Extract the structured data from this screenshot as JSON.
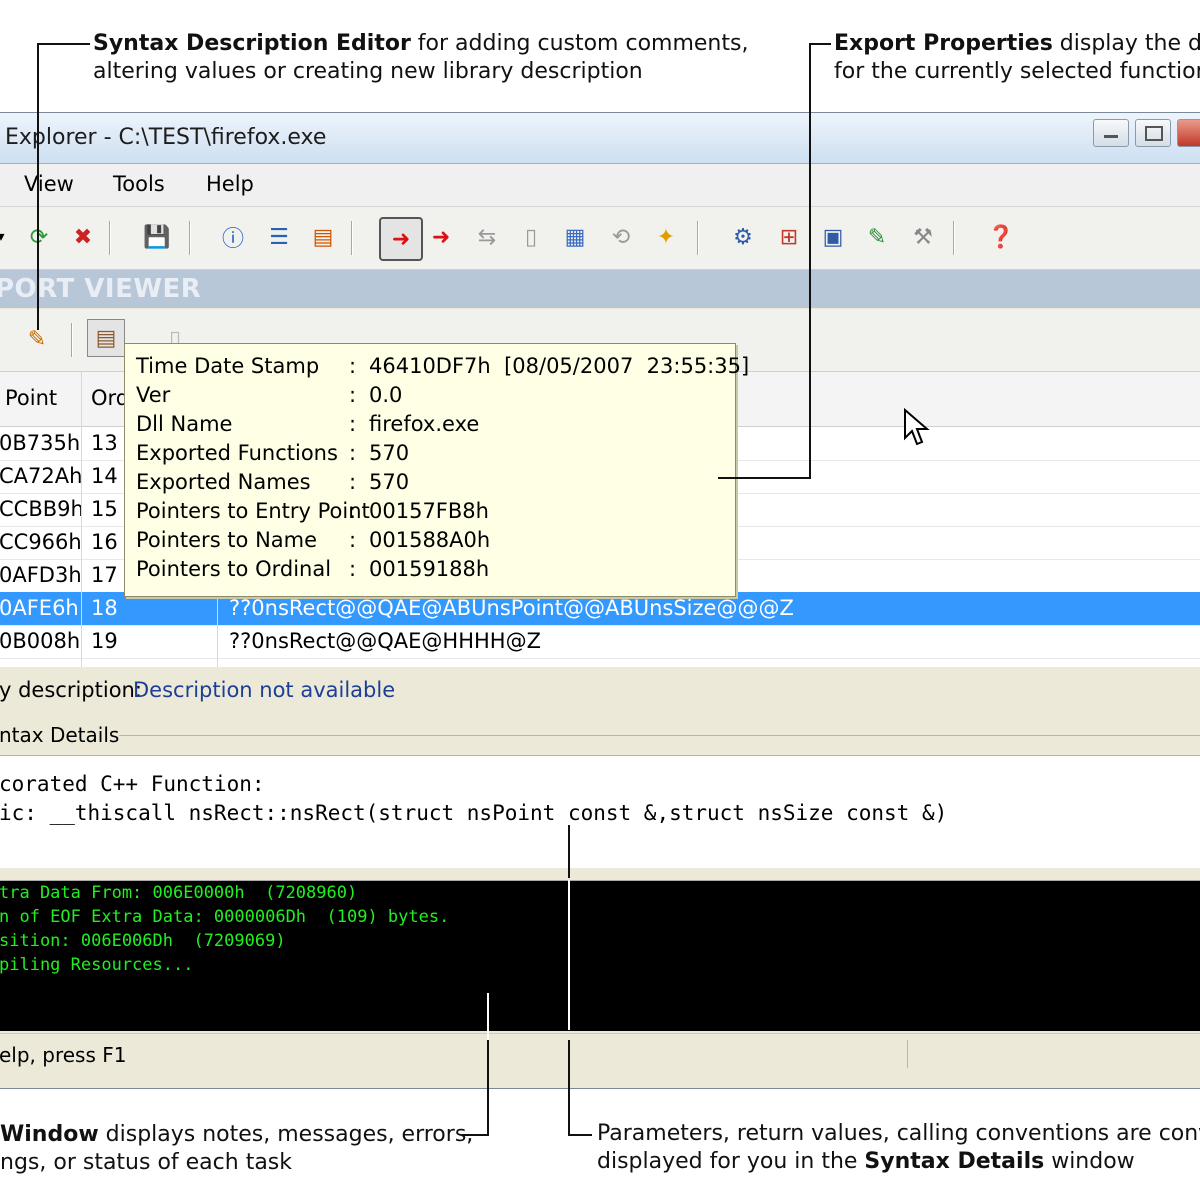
{
  "callouts": {
    "syntax_editor": {
      "bold": "Syntax Description Editor",
      "rest": " for adding custom comments,",
      "line2": "altering values or creating new library description"
    },
    "export_props": {
      "bold": "Export Properties",
      "rest": " display the de",
      "line2": "for the currently selected function"
    },
    "output_window": {
      "bold": "Window",
      "rest": " displays notes, messages, errors,",
      "line2": "ngs, or status of each task"
    },
    "syntax_details": {
      "line1": "Parameters, return values, calling conventions are conver",
      "line2_pre": "displayed for you in the ",
      "line2_bold": "Syntax Details",
      "line2_post": " window"
    }
  },
  "window": {
    "title": "Explorer - C:\\TEST\\firefox.exe"
  },
  "menu": {
    "view": "View",
    "tools": "Tools",
    "help": "Help"
  },
  "panel": {
    "title": "PORT VIEWER"
  },
  "grid": {
    "headers": {
      "entry_point": "Point",
      "ordinal": "Ord"
    },
    "rows": [
      {
        "entry": "0B735h",
        "ord": "13",
        "name": ""
      },
      {
        "entry": "CA72Ah",
        "ord": "14",
        "name": ""
      },
      {
        "entry": "CCBB9h",
        "ord": "15",
        "name": ""
      },
      {
        "entry": "CC966h",
        "ord": "16",
        "name": ""
      },
      {
        "entry": "0AFD3h",
        "ord": "17",
        "name": ""
      },
      {
        "entry": "0AFE6h",
        "ord": "18",
        "name": "??0nsRect@@QAE@ABUnsPoint@@ABUnsSize@@@Z"
      },
      {
        "entry": "0B008h",
        "ord": "19",
        "name": "??0nsRect@@QAE@HHHH@Z"
      }
    ]
  },
  "tooltip": {
    "rows": [
      {
        "label": "Time Date Stamp",
        "value": "46410DF7h  [08/05/2007  23:55:35]"
      },
      {
        "label": "Ver",
        "value": "0.0"
      },
      {
        "label": "Dll Name",
        "value": "firefox.exe"
      },
      {
        "label": "Exported Functions",
        "value": "570"
      },
      {
        "label": "Exported Names",
        "value": "570"
      },
      {
        "label": "Pointers to Entry Point",
        "value": "00157FB8h"
      },
      {
        "label": "Pointers to Name",
        "value": "001588A0h"
      },
      {
        "label": "Pointers to Ordinal",
        "value": "00159188h"
      }
    ]
  },
  "description": {
    "label": "y description:",
    "value": "Description not available"
  },
  "syntax": {
    "group_label": "ntax Details",
    "line1": "corated C++ Function:",
    "line2": "ic: __thiscall nsRect::nsRect(struct nsPoint const &,struct nsSize const &)"
  },
  "console": {
    "lines": [
      "tra Data From: 006E0000h  (7208960)",
      "n of EOF Extra Data: 0000006Dh  (109) bytes.",
      "sition: 006E006Dh  (7209069)",
      "piling Resources..."
    ]
  },
  "status": {
    "text": "elp, press F1"
  },
  "colors": {
    "selected": "#3399ff",
    "console_text": "#22ee22",
    "link_text": "#1c3f95"
  }
}
